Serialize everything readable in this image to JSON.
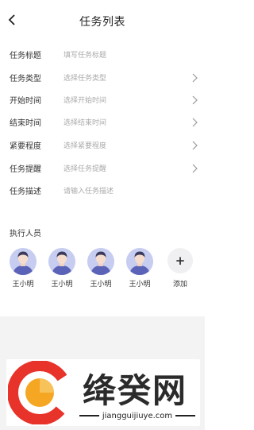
{
  "header": {
    "title": "任务列表",
    "back_icon": "chevron-left-icon"
  },
  "form": {
    "rows": [
      {
        "label": "任务标题",
        "placeholder": "填写任务标题",
        "has_chevron": false
      },
      {
        "label": "任务类型",
        "placeholder": "选择任务类型",
        "has_chevron": true
      },
      {
        "label": "开始时间",
        "placeholder": "选择开始时间",
        "has_chevron": true
      },
      {
        "label": "结束时间",
        "placeholder": "选择结束时间",
        "has_chevron": true
      },
      {
        "label": "紧要程度",
        "placeholder": "选择紧要程度",
        "has_chevron": true
      },
      {
        "label": "任务提醒",
        "placeholder": "选择任务提醒",
        "has_chevron": true
      },
      {
        "label": "任务描述",
        "placeholder": "请输入任务描述",
        "has_chevron": false
      }
    ]
  },
  "executors": {
    "title": "执行人员",
    "members": [
      {
        "name": "王小明"
      },
      {
        "name": "王小明"
      },
      {
        "name": "王小明"
      },
      {
        "name": "王小明"
      }
    ],
    "add_label": "添加",
    "add_symbol": "+"
  },
  "watermark": {
    "brand": "绛癸网",
    "url": "jiangguijiuye.com"
  },
  "colors": {
    "placeholder": "#aaaaaa",
    "avatar_bg": "#c7cdf0",
    "avatar_figure": "#5b63b8",
    "logo_red": "#e8332a",
    "logo_orange": "#f5a623"
  }
}
